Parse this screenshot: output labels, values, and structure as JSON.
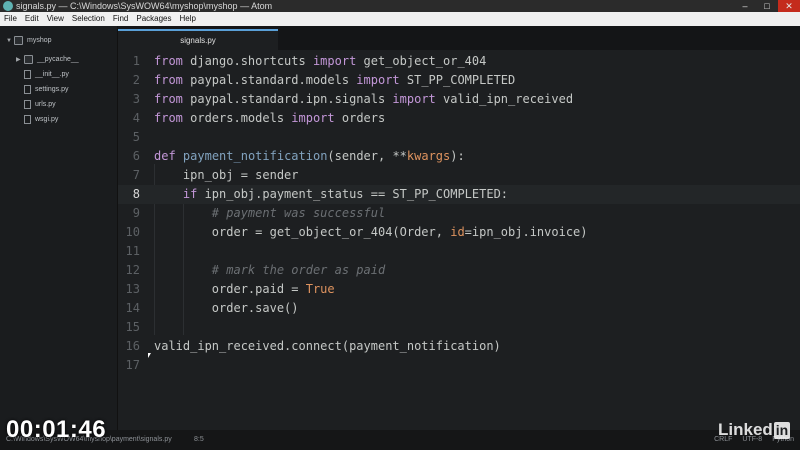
{
  "window": {
    "title": "signals.py — C:\\Windows\\SysWOW64\\myshop\\myshop — Atom",
    "controls": {
      "minimize": "–",
      "maximize": "□",
      "close": "✕"
    }
  },
  "menu": [
    "File",
    "Edit",
    "View",
    "Selection",
    "Find",
    "Packages",
    "Help"
  ],
  "tree": {
    "root": "myshop",
    "items": [
      "__pycache__",
      "__init__.py",
      "settings.py",
      "urls.py",
      "wsgi.py"
    ]
  },
  "tabs": [
    {
      "label": "signals.py",
      "active": true
    }
  ],
  "editor": {
    "cursor_line": 8,
    "lines": [
      {
        "n": "1"
      },
      {
        "n": "2"
      },
      {
        "n": "3"
      },
      {
        "n": "4"
      },
      {
        "n": "5"
      },
      {
        "n": "6"
      },
      {
        "n": "7"
      },
      {
        "n": "8"
      },
      {
        "n": "9"
      },
      {
        "n": "10"
      },
      {
        "n": "11"
      },
      {
        "n": "12"
      },
      {
        "n": "13"
      },
      {
        "n": "14"
      },
      {
        "n": "15"
      },
      {
        "n": "16"
      },
      {
        "n": "17"
      }
    ],
    "tokens": {
      "l1": [
        "from",
        " django.shortcuts ",
        "import",
        " get_object_or_404"
      ],
      "l2": [
        "from",
        " paypal.standard.models ",
        "import",
        " ST_PP_COMPLETED"
      ],
      "l3": [
        "from",
        " paypal.standard.ipn.signals ",
        "import",
        " valid_ipn_received"
      ],
      "l4": [
        "from",
        " orders.models ",
        "import",
        " orders"
      ],
      "l6": [
        "def",
        " ",
        "payment_notification",
        "(sender, **",
        "kwargs",
        "):"
      ],
      "l7": [
        "    ipn_obj = sender"
      ],
      "l8": [
        "    ",
        "if",
        " ipn_obj.payment_status == ST_PP_COMPLETED:"
      ],
      "l9": [
        "        ",
        "# payment was successful"
      ],
      "l10": [
        "        order = get_object_or_404(Order, ",
        "id",
        "=ipn_obj.invoice)"
      ],
      "l12": [
        "        ",
        "# mark the order as paid"
      ],
      "l13": [
        "        order.paid = ",
        "True"
      ],
      "l14": [
        "        order.save()"
      ],
      "l16": [
        "valid_ipn_received.connect(payment_notification)"
      ]
    }
  },
  "status": {
    "path": "C:\\Windows\\SysWOW64\\myshop\\payment\\signals.py",
    "position": "8:5",
    "line_ending": "CRLF",
    "encoding": "UTF-8",
    "grammar": "Python"
  },
  "overlay": {
    "timestamp": "00:01:46",
    "brand": "Linked",
    "brand_in": "in"
  },
  "colors": {
    "keyword": "#c397d8",
    "function": "#81a2be",
    "parameter": "#de935f",
    "comment": "#6b6f73",
    "accent_tab": "#5aa0d8"
  }
}
